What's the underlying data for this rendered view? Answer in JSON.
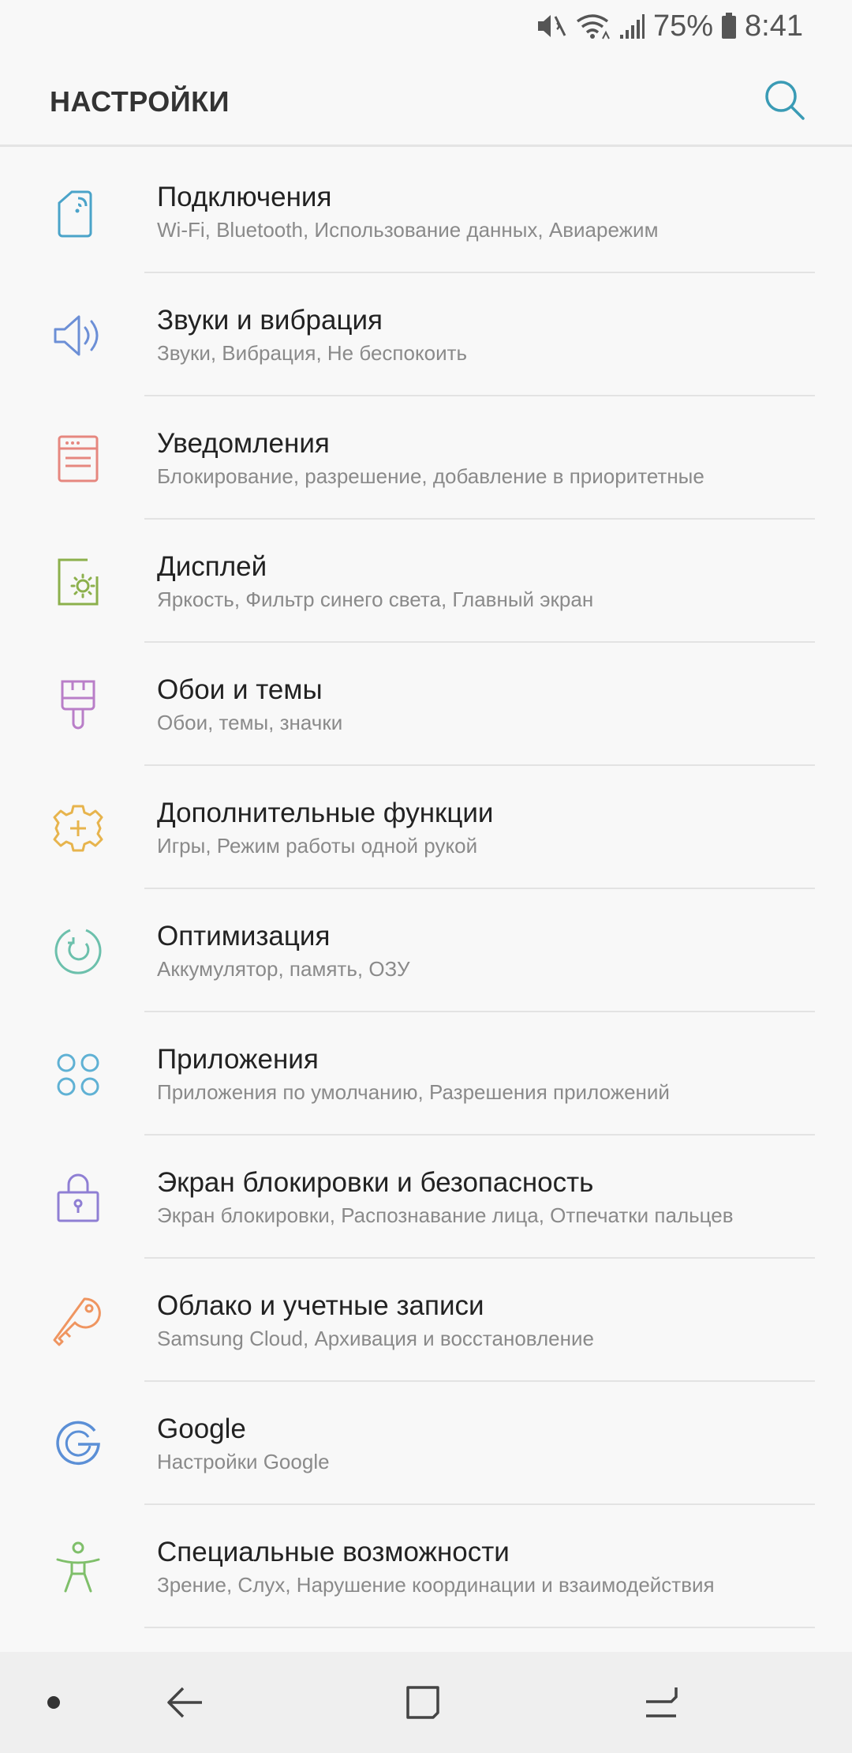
{
  "status_bar": {
    "battery": "75%",
    "time": "8:41",
    "icons": [
      "mute-icon",
      "wifi-icon",
      "signal-icon",
      "battery-icon"
    ]
  },
  "header": {
    "title": "НАСТРОЙКИ",
    "search_icon": "search-icon",
    "accent": "#3a9bb5"
  },
  "settings": [
    {
      "title": "Подключения",
      "subtitle": "Wi-Fi, Bluetooth, Использование данных, Авиарежим",
      "icon": "connections-icon",
      "color": "#4aa3c9"
    },
    {
      "title": "Звуки и вибрация",
      "subtitle": "Звуки, Вибрация, Не беспокоить",
      "icon": "sound-icon",
      "color": "#6c8fd6"
    },
    {
      "title": "Уведомления",
      "subtitle": "Блокирование, разрешение, добавление в приоритетные",
      "icon": "notifications-icon",
      "color": "#e6877f"
    },
    {
      "title": "Дисплей",
      "subtitle": "Яркость, Фильтр синего света, Главный экран",
      "icon": "display-icon",
      "color": "#8cb04c"
    },
    {
      "title": "Обои и темы",
      "subtitle": "Обои, темы, значки",
      "icon": "brush-icon",
      "color": "#b97ec8"
    },
    {
      "title": "Дополнительные функции",
      "subtitle": "Игры, Режим работы одной рукой",
      "icon": "gear-plus-icon",
      "color": "#e7b44d"
    },
    {
      "title": "Оптимизация",
      "subtitle": "Аккумулятор, память, ОЗУ",
      "icon": "optimize-icon",
      "color": "#6cc0ac"
    },
    {
      "title": "Приложения",
      "subtitle": "Приложения по умолчанию, Разрешения приложений",
      "icon": "apps-icon",
      "color": "#5fb1d4"
    },
    {
      "title": "Экран блокировки и безопасность",
      "subtitle": "Экран блокировки, Распознавание лица, Отпечатки пальцев",
      "icon": "lock-icon",
      "color": "#8f7fd4"
    },
    {
      "title": "Облако и учетные записи",
      "subtitle": "Samsung Cloud, Архивация и восстановление",
      "icon": "key-icon",
      "color": "#ef9560"
    },
    {
      "title": "Google",
      "subtitle": "Настройки Google",
      "icon": "google-icon",
      "color": "#5b8fd6"
    },
    {
      "title": "Специальные возможности",
      "subtitle": "Зрение, Слух, Нарушение координации и взаимодействия",
      "icon": "accessibility-icon",
      "color": "#7fbf6a"
    }
  ],
  "nav_bar": {
    "icons": [
      "dot-icon",
      "back-icon",
      "home-icon",
      "recents-icon"
    ]
  }
}
